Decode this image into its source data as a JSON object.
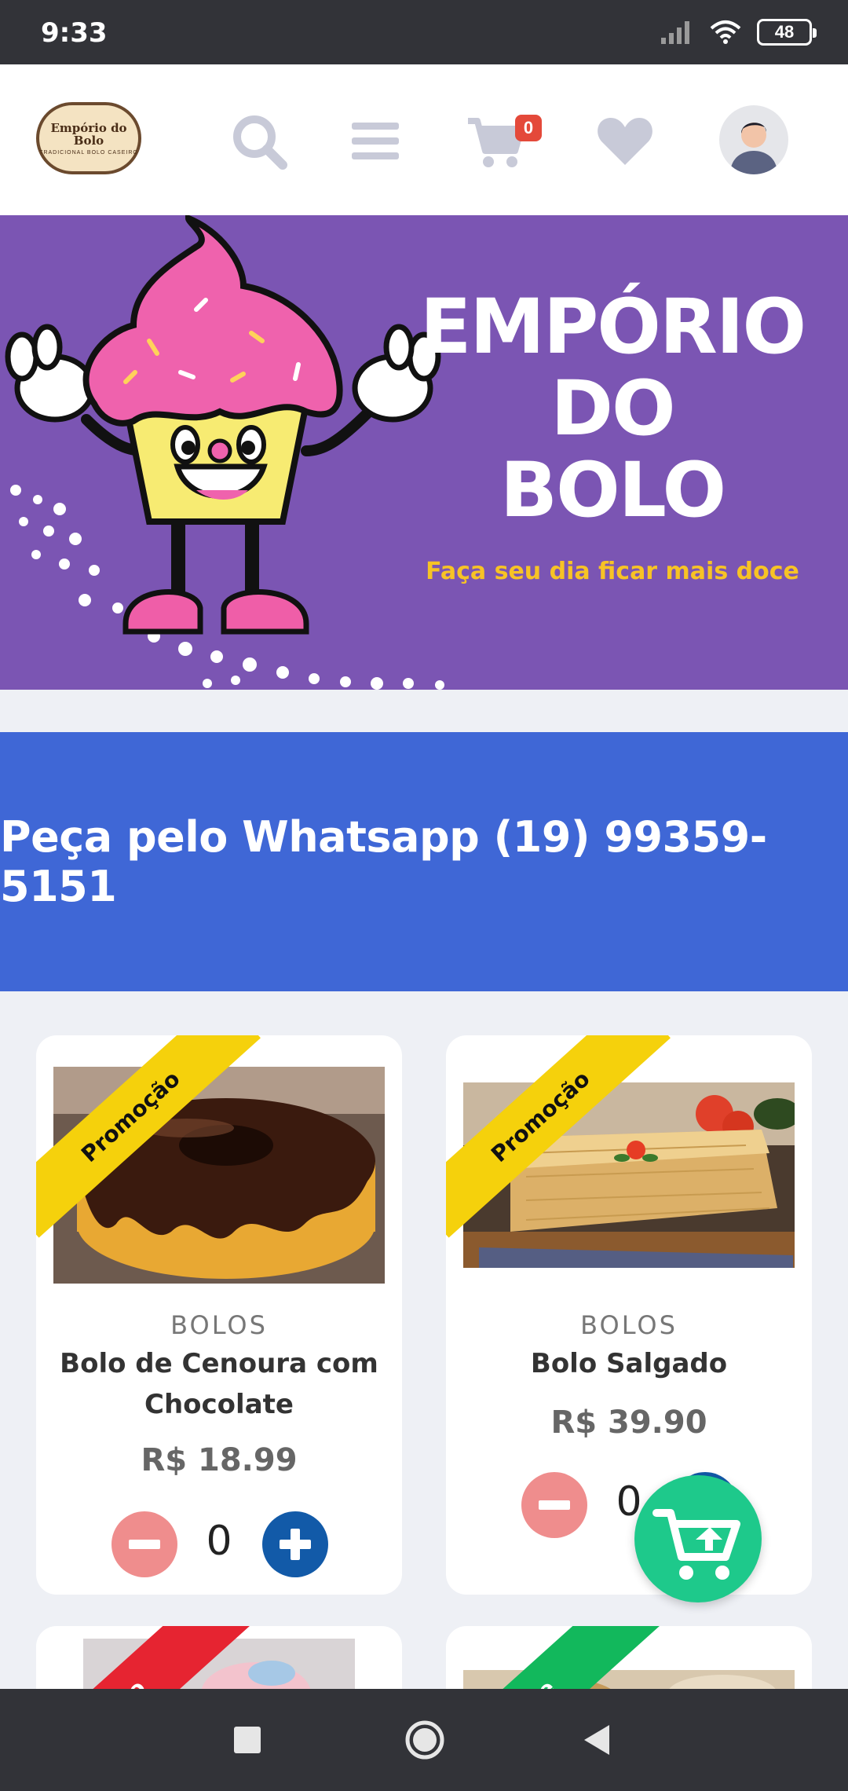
{
  "status_bar": {
    "time": "9:33",
    "battery": "48"
  },
  "header": {
    "logo_title": "Empório do Bolo",
    "logo_subtitle": "TRADICIONAL BOLO CASEIRO",
    "cart_count": "0"
  },
  "hero": {
    "title_lines": [
      "EMPÓRIO",
      "DO",
      "BOLO"
    ],
    "subtitle": "Faça seu dia ficar mais doce"
  },
  "banner": {
    "text": "Peça pelo Whatsapp (19) 99359-5151"
  },
  "products": [
    {
      "badge": "Promoção",
      "category": "BOLOS",
      "name": "Bolo de Cenoura com Chocolate",
      "price": "R$ 18.99",
      "quantity": "0"
    },
    {
      "badge": "Promoção",
      "category": "BOLOS",
      "name": "Bolo Salgado",
      "price": "R$ 39.90",
      "quantity": "0"
    },
    {
      "badge": "do",
      "category": "",
      "name": "",
      "price": "",
      "quantity": ""
    },
    {
      "badge": "ue",
      "category": "",
      "name": "",
      "price": "",
      "quantity": ""
    }
  ],
  "colors": {
    "hero_bg": "#7b55b3",
    "banner_bg": "#3f67d6",
    "promo_ribbon": "#f5d10c",
    "red_ribbon": "#e62431",
    "green_ribbon": "#12b85c",
    "fab": "#1ec98b"
  }
}
